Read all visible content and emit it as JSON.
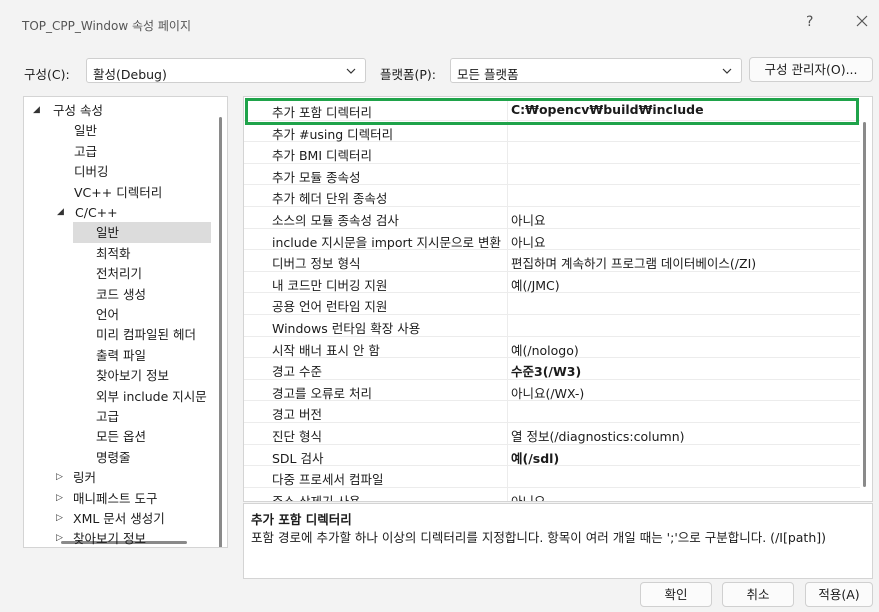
{
  "window": {
    "title": "TOP_CPP_Window 속성 페이지",
    "help_label": "?"
  },
  "config_row": {
    "config_label": "구성(C):",
    "config_value": "활성(Debug)",
    "platform_label": "플랫폼(P):",
    "platform_value": "모든 플랫폼",
    "manager_button": "구성 관리자(O)..."
  },
  "tree": {
    "items": [
      {
        "label": "구성 속성",
        "caret": "◢"
      },
      {
        "label": "일반"
      },
      {
        "label": "고급"
      },
      {
        "label": "디버깅"
      },
      {
        "label": "VC++ 디렉터리"
      },
      {
        "label": "C/C++",
        "caret": "◢"
      },
      {
        "label": "일반",
        "selected": true
      },
      {
        "label": "최적화"
      },
      {
        "label": "전처리기"
      },
      {
        "label": "코드 생성"
      },
      {
        "label": "언어"
      },
      {
        "label": "미리 컴파일된 헤더"
      },
      {
        "label": "출력 파일"
      },
      {
        "label": "찾아보기 정보"
      },
      {
        "label": "외부 include 지시문"
      },
      {
        "label": "고급"
      },
      {
        "label": "모든 옵션"
      },
      {
        "label": "명령줄"
      },
      {
        "label": "링커",
        "caret": "▷"
      },
      {
        "label": "매니페스트 도구",
        "caret": "▷"
      },
      {
        "label": "XML 문서 생성기",
        "caret": "▷"
      },
      {
        "label": "찾아보기 정보",
        "caret": "▷"
      }
    ]
  },
  "grid": {
    "rows": [
      {
        "name": "추가 포함 디렉터리",
        "value": "C:₩opencv₩build₩include",
        "bold": true
      },
      {
        "name": "추가 #using 디렉터리",
        "value": ""
      },
      {
        "name": "추가 BMI 디렉터리",
        "value": ""
      },
      {
        "name": "추가 모듈 종속성",
        "value": ""
      },
      {
        "name": "추가 헤더 단위 종속성",
        "value": ""
      },
      {
        "name": "소스의 모듈 종속성 검사",
        "value": "아니요"
      },
      {
        "name": "include 지시문을 import 지시문으로 변환",
        "value": "아니요"
      },
      {
        "name": "디버그 정보 형식",
        "value": "편집하며 계속하기 프로그램 데이터베이스(/ZI)"
      },
      {
        "name": "내 코드만 디버깅 지원",
        "value": "예(/JMC)"
      },
      {
        "name": "공용 언어 런타임 지원",
        "value": ""
      },
      {
        "name": "Windows 런타임 확장 사용",
        "value": ""
      },
      {
        "name": "시작 배너 표시 안 함",
        "value": "예(/nologo)"
      },
      {
        "name": "경고 수준",
        "value": "수준3(/W3)",
        "bold": true
      },
      {
        "name": "경고를 오류로 처리",
        "value": "아니요(/WX-)"
      },
      {
        "name": "경고 버전",
        "value": ""
      },
      {
        "name": "진단 형식",
        "value": "열 정보(/diagnostics:column)"
      },
      {
        "name": "SDL 검사",
        "value": "예(/sdl)",
        "bold": true
      },
      {
        "name": "다중 프로세서 컴파일",
        "value": ""
      },
      {
        "name": "주소 삭제기 사용",
        "value": "아니요"
      }
    ]
  },
  "description": {
    "title": "추가 포함 디렉터리",
    "text": "포함 경로에 추가할 하나 이상의 디렉터리를 지정합니다. 항목이 여러 개일 때는 ';'으로 구분합니다. (/I[path])"
  },
  "buttons": {
    "ok": "확인",
    "cancel": "취소",
    "apply": "적용(A)"
  }
}
